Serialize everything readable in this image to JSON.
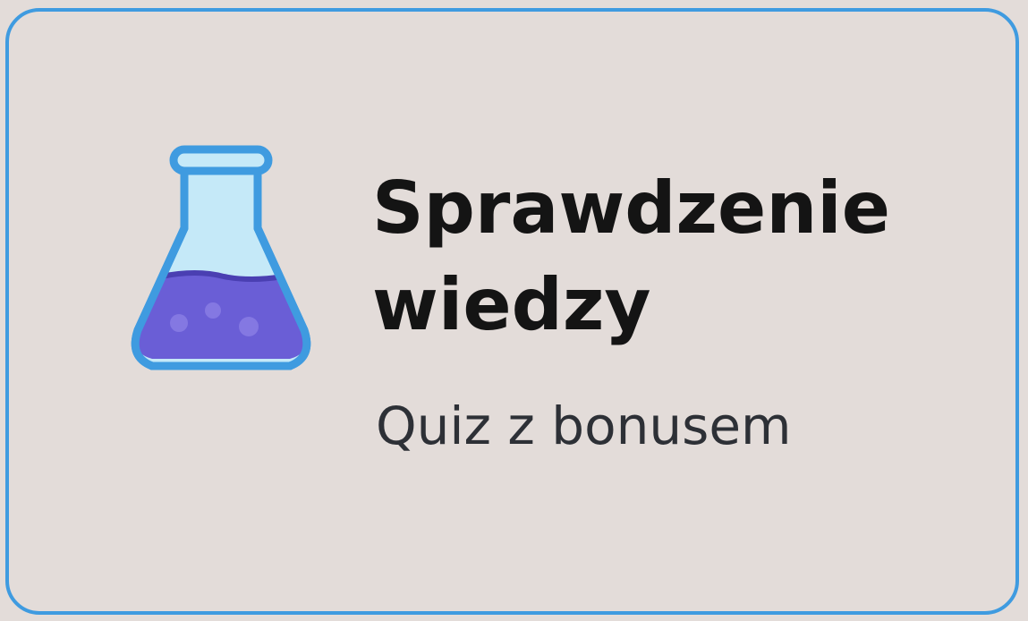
{
  "card": {
    "title_line1": "Sprawdzenie",
    "title_line2": "wiedzy",
    "subtitle": "Quiz z bonusem",
    "icon": "flask-icon",
    "colors": {
      "border": "#3f9be0",
      "background": "#e3dcd9",
      "liquid": "#6a5ed6",
      "glass": "#bfe6f7"
    }
  }
}
